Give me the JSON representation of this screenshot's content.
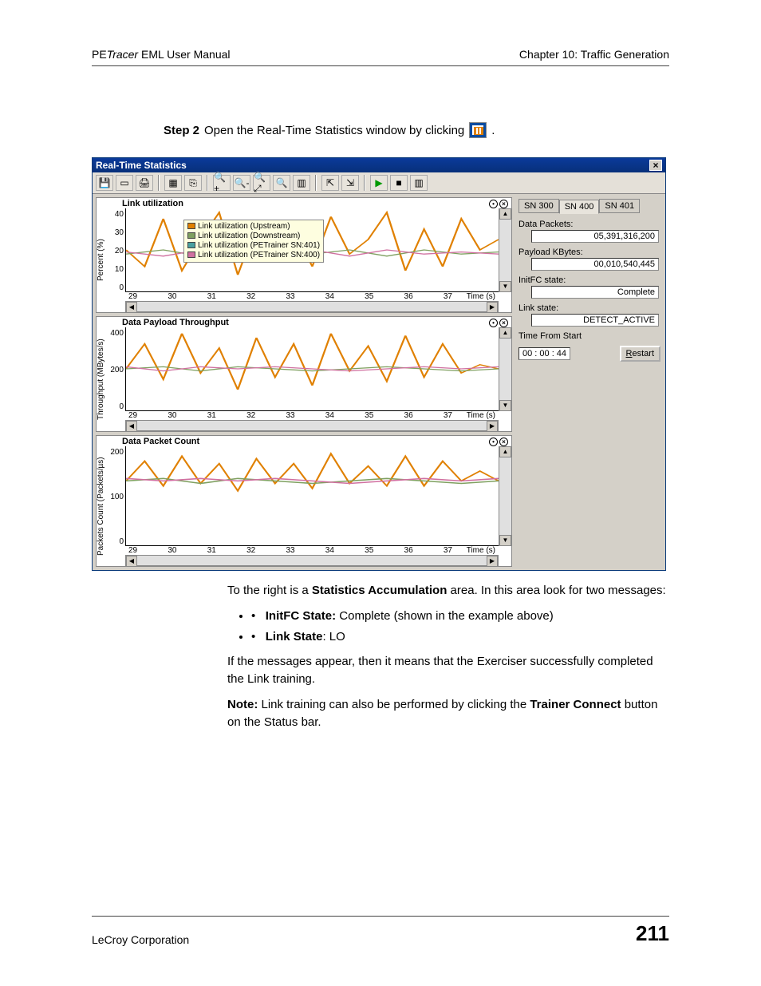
{
  "header": {
    "left_prefix": "PE",
    "left_italic": "Tracer",
    "left_suffix": " EML User Manual",
    "right": "Chapter 10: Traffic Generation"
  },
  "step": {
    "label": "Step 2",
    "text": "Open the Real-Time Statistics window by clicking",
    "trail": "."
  },
  "window": {
    "title": "Real-Time Statistics",
    "close_x": "×",
    "toolbar_glyphs": [
      "💾",
      "▭",
      "🖨",
      "▦",
      "⎘",
      "🔍+",
      "🔍-",
      "🔍⤢",
      "🔍",
      "▥",
      "⇱",
      "⇲",
      "▶",
      "■",
      "▥"
    ],
    "tabs": [
      {
        "label": "SN 300",
        "active": false
      },
      {
        "label": "SN 400",
        "active": true
      },
      {
        "label": "SN 401",
        "active": false
      }
    ],
    "stats": {
      "data_packets_label": "Data Packets:",
      "data_packets_value": "05,391,316,200",
      "payload_kb_label": "Payload KBytes:",
      "payload_kb_value": "00,010,540,445",
      "initfc_label": "InitFC state:",
      "initfc_value": "Complete",
      "link_state_label": "Link state:",
      "link_state_value": "DETECT_ACTIVE",
      "time_from_start_label": "Time From Start",
      "time_from_start_value": "00 : 00 : 44",
      "restart_label": "Restart"
    }
  },
  "charts": [
    {
      "title": "Link utilization",
      "yaxis": "Percent (%)",
      "xaxis": "Time (s)",
      "yticks": [
        "40",
        "30",
        "20",
        "10",
        "0"
      ],
      "xticks": [
        "29",
        "30",
        "31",
        "32",
        "33",
        "34",
        "35",
        "36",
        "37"
      ],
      "legend": [
        {
          "color": "#e08000",
          "label": "Link utilization (Upstream)"
        },
        {
          "color": "#7fa060",
          "label": "Link utilization (Downstream)"
        },
        {
          "color": "#4aa0a0",
          "label": "Link utilization (PETrainer SN:401)"
        },
        {
          "color": "#d070a0",
          "label": "Link utilization (PETrainer SN:400)"
        }
      ]
    },
    {
      "title": "Data Payload Throughput",
      "yaxis": "Throughput (MBytes/s)",
      "xaxis": "Time (s)",
      "yticks": [
        "400",
        "200",
        "0"
      ],
      "xticks": [
        "29",
        "30",
        "31",
        "32",
        "33",
        "34",
        "35",
        "36",
        "37"
      ]
    },
    {
      "title": "Data Packet Count",
      "yaxis": "Packets Count (Packets/µs)",
      "xaxis": "Time (s)",
      "yticks": [
        "200",
        "100",
        "0"
      ],
      "xticks": [
        "29",
        "30",
        "31",
        "32",
        "33",
        "34",
        "35",
        "36",
        "37"
      ]
    }
  ],
  "chart_data": [
    {
      "type": "line",
      "title": "Link utilization",
      "xlabel": "Time (s)",
      "ylabel": "Percent (%)",
      "ylim": [
        0,
        40
      ],
      "x": [
        29,
        30,
        31,
        32,
        33,
        34,
        35,
        36,
        37
      ],
      "series": [
        {
          "name": "Link utilization (Upstream)",
          "color": "#e08000",
          "values": [
            22,
            15,
            38,
            12,
            25,
            40,
            10,
            35,
            18,
            30,
            15,
            38,
            20,
            25,
            40,
            12,
            30,
            15,
            38
          ]
        },
        {
          "name": "Link utilization (Downstream)",
          "color": "#7fa060",
          "values": [
            18,
            20,
            17,
            19,
            22,
            18,
            20,
            17,
            21,
            18,
            20,
            19,
            17,
            21,
            18,
            22,
            17,
            20,
            18
          ]
        },
        {
          "name": "Link utilization (PETrainer SN:401)",
          "color": "#4aa0a0",
          "values": [
            16,
            17,
            16,
            18,
            17,
            16,
            17,
            18,
            16,
            17,
            16,
            18,
            17,
            16,
            17,
            18,
            16,
            17,
            16
          ]
        },
        {
          "name": "Link utilization (PETrainer SN:400)",
          "color": "#d070a0",
          "values": [
            19,
            18,
            20,
            17,
            19,
            18,
            20,
            17,
            19,
            18,
            20,
            19,
            17,
            20,
            18,
            19,
            17,
            20,
            18
          ]
        }
      ]
    },
    {
      "type": "line",
      "title": "Data Payload Throughput",
      "xlabel": "Time (s)",
      "ylabel": "Throughput (MBytes/s)",
      "ylim": [
        0,
        400
      ],
      "x": [
        29,
        30,
        31,
        32,
        33,
        34,
        35,
        36,
        37
      ],
      "series": [
        {
          "name": "Upstream",
          "color": "#e08000",
          "values": [
            200,
            320,
            150,
            380,
            180,
            300,
            120,
            360,
            170,
            330,
            140,
            380,
            190,
            310,
            150,
            370,
            160,
            320,
            180
          ]
        },
        {
          "name": "Downstream",
          "color": "#7fa060",
          "values": [
            200,
            210,
            195,
            205,
            215,
            200,
            210,
            198,
            212,
            200,
            208,
            202,
            196,
            214,
            199,
            210,
            197,
            209,
            200
          ]
        },
        {
          "name": "PETrainer SN:401",
          "color": "#4aa0a0",
          "values": [
            195,
            200,
            190,
            198,
            202,
            195,
            200,
            192,
            201,
            195,
            199,
            196,
            193,
            202,
            194,
            200,
            192,
            199,
            195
          ]
        },
        {
          "name": "PETrainer SN:400",
          "color": "#d070a0",
          "values": [
            205,
            200,
            210,
            198,
            208,
            202,
            210,
            197,
            209,
            203,
            210,
            206,
            196,
            210,
            201,
            208,
            197,
            209,
            204
          ]
        }
      ]
    },
    {
      "type": "line",
      "title": "Data Packet Count",
      "xlabel": "Time (s)",
      "ylabel": "Packets Count (Packets/µs)",
      "ylim": [
        0,
        200
      ],
      "x": [
        29,
        30,
        31,
        32,
        33,
        34,
        35,
        36,
        37
      ],
      "series": [
        {
          "name": "Upstream",
          "color": "#e08000",
          "values": [
            130,
            170,
            120,
            180,
            125,
            165,
            110,
            175,
            128,
            168,
            118,
            182,
            126,
            162,
            120,
            178,
            122,
            170,
            130
          ]
        },
        {
          "name": "Downstream",
          "color": "#7fa060",
          "values": [
            128,
            132,
            126,
            130,
            134,
            128,
            131,
            127,
            133,
            128,
            130,
            129,
            126,
            134,
            127,
            131,
            126,
            130,
            128
          ]
        },
        {
          "name": "PETrainer SN:401",
          "color": "#4aa0a0",
          "values": [
            125,
            127,
            124,
            126,
            128,
            125,
            127,
            124,
            128,
            125,
            127,
            126,
            124,
            128,
            124,
            127,
            124,
            126,
            125
          ]
        },
        {
          "name": "PETrainer SN:400",
          "color": "#d070a0",
          "values": [
            132,
            129,
            134,
            127,
            133,
            130,
            134,
            126,
            133,
            131,
            134,
            132,
            126,
            134,
            129,
            133,
            126,
            132,
            130
          ]
        }
      ]
    }
  ],
  "body": {
    "p1_a": "To the right is a ",
    "p1_b": "Statistics Accumulation",
    "p1_c": " area. In this area look for two messages:",
    "li1_b": "InitFC State:",
    "li1_t": " Complete (shown in the example above)",
    "li2_b": "Link State",
    "li2_t": ": LO",
    "p2": "If the messages appear, then it means that the Exerciser successfully completed the Link training.",
    "p3_a": "Note:",
    "p3_b": " Link training can also be performed by clicking the ",
    "p3_c": "Trainer Connect",
    "p3_d": " button on the Status bar."
  },
  "footer": {
    "left": "LeCroy Corporation",
    "page": "211"
  }
}
